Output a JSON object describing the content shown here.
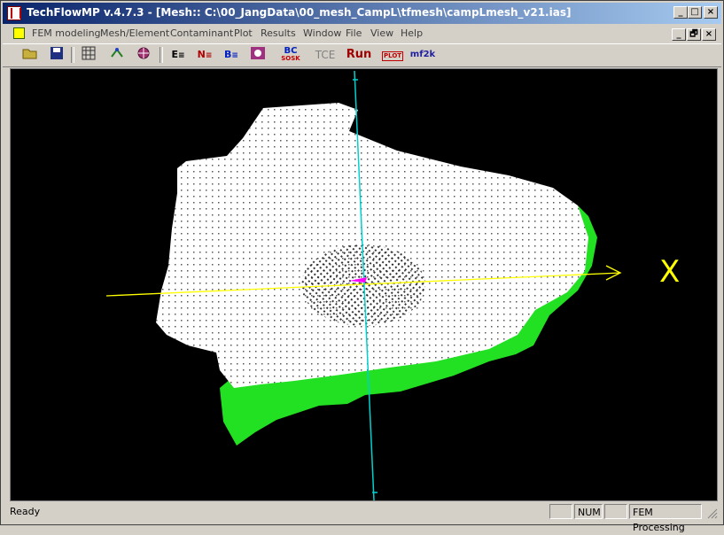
{
  "window": {
    "title": "TechFlowMP v.4.7.3 - [Mesh:: C:\\00_JangData\\00_mesh_CampL\\tfmesh\\campLmesh_v21.ias]",
    "min_label": "_",
    "max_label": "□",
    "close_label": "×",
    "restore_label": "🗗"
  },
  "menubar": {
    "items": [
      "FEM modeling",
      "Mesh/Element",
      "Contaminant",
      "Plot",
      "Results",
      "Window",
      "File",
      "View",
      "Help"
    ]
  },
  "toolbar": {
    "e_label": "E",
    "n_label": "N",
    "b_label": "B",
    "bc_top": "BC",
    "bc_bottom": "SOSK",
    "tce_label": "TCE",
    "run_label": "Run",
    "plot_label": "PLOT",
    "mf2k_label": "mf2k"
  },
  "viewport": {
    "axis_x_label": "X",
    "colors": {
      "background": "#000000",
      "mesh_top": "#ffffff",
      "mesh_side": "#22e022",
      "x_axis": "#ffff00",
      "z_axis": "#00d0d0",
      "center_marker": "#ff00ff"
    }
  },
  "statusbar": {
    "text": "Ready",
    "num": "NUM",
    "mode": "FEM Processing"
  }
}
